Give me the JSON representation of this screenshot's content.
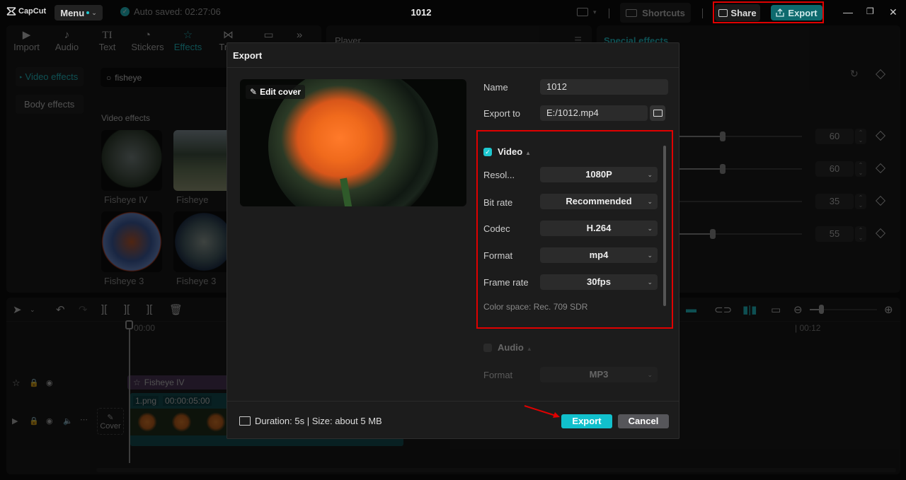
{
  "titlebar": {
    "app_name": "CapCut",
    "menu_label": "Menu",
    "autosave_text": "Auto saved: 02:27:06",
    "project_title": "1012",
    "shortcuts_label": "Shortcuts",
    "share_label": "Share",
    "export_label": "Export"
  },
  "media_panel": {
    "tools": [
      {
        "label": "Import",
        "icon": "import-icon"
      },
      {
        "label": "Audio",
        "icon": "audio-icon"
      },
      {
        "label": "Text",
        "icon": "text-icon"
      },
      {
        "label": "Stickers",
        "icon": "stickers-icon"
      },
      {
        "label": "Effects",
        "icon": "effects-icon",
        "active": true
      },
      {
        "label": "Tran",
        "icon": "transitions-icon"
      },
      {
        "label": "",
        "icon": "captions-icon"
      }
    ],
    "more_label": "»",
    "sidebar": [
      {
        "label": "Video effects",
        "active": true
      },
      {
        "label": "Body effects"
      }
    ],
    "search_value": "fisheye",
    "section_label": "Video effects",
    "effects": [
      {
        "label": "Fisheye IV"
      },
      {
        "label": "Fisheye"
      },
      {
        "label": "Fisheye 3"
      },
      {
        "label": "Fisheye 3"
      }
    ]
  },
  "player": {
    "title": "Player"
  },
  "effects_panel": {
    "title": "Special effects",
    "params": [
      {
        "value": "60",
        "fraction": 0.35
      },
      {
        "value": "60",
        "fraction": 0.35
      },
      {
        "value": "35",
        "fraction": 0.0
      },
      {
        "value": "55",
        "fraction": 0.27
      }
    ]
  },
  "timeline": {
    "time_start": "00:00",
    "time_mark": "| 00:12",
    "effect_clip_label": "Fisheye IV",
    "video_clip_name": "1.png",
    "video_clip_duration": "00:00:05:00",
    "cover_label": "Cover"
  },
  "export_dialog": {
    "title": "Export",
    "edit_cover_label": "Edit cover",
    "name_label": "Name",
    "name_value": "1012",
    "export_to_label": "Export to",
    "export_to_value": "E:/1012.mp4",
    "video_section": {
      "title": "Video",
      "checked": true,
      "fields": [
        {
          "label": "Resol...",
          "value": "1080P"
        },
        {
          "label": "Bit rate",
          "value": "Recommended"
        },
        {
          "label": "Codec",
          "value": "H.264"
        },
        {
          "label": "Format",
          "value": "mp4"
        },
        {
          "label": "Frame rate",
          "value": "30fps"
        }
      ],
      "color_space": "Color space: Rec. 709 SDR"
    },
    "audio_section": {
      "title": "Audio",
      "checked": false,
      "format_label": "Format",
      "format_value": "MP3"
    },
    "footer_info": "Duration: 5s | Size: about 5 MB",
    "export_button": "Export",
    "cancel_button": "Cancel"
  },
  "colors": {
    "accent": "#1ec8d0",
    "export_button": "#11c0cc",
    "annotation_red": "#e00000",
    "background": "#050505"
  }
}
